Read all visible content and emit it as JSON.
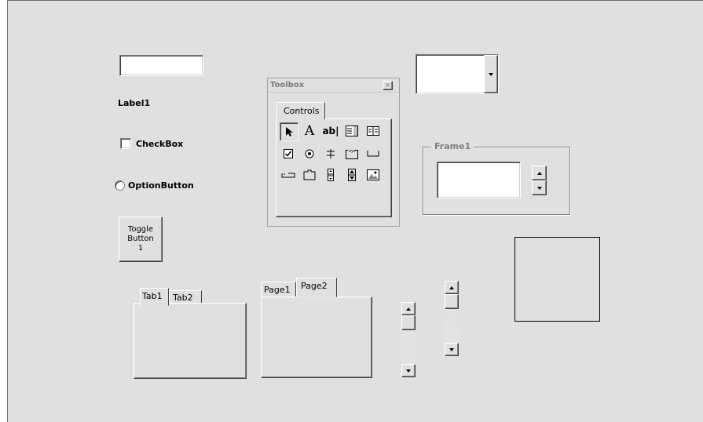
{
  "form": {
    "label1": "Label1",
    "checkbox": "CheckBox",
    "option_button": "OptionButton",
    "toggle_button": [
      "Toggle",
      "Button",
      "1"
    ],
    "frame1": "Frame1",
    "tabstrip": [
      "Tab1",
      "Tab2"
    ],
    "multipage": [
      "Page1",
      "Page2"
    ]
  },
  "toolbox": {
    "title": "Toolbox",
    "tab": "Controls",
    "icons": [
      [
        "select-objects-icon",
        "label-icon",
        "textbox-icon",
        "combobox-icon",
        "listbox-icon"
      ],
      [
        "checkbox-icon",
        "optionbutton-icon",
        "togglebutton-icon",
        "frame-icon",
        "commandbutton-icon"
      ],
      [
        "tabstrip-icon",
        "multipage-icon",
        "scrollbar-icon",
        "spinbutton-icon",
        "image-icon"
      ]
    ]
  }
}
